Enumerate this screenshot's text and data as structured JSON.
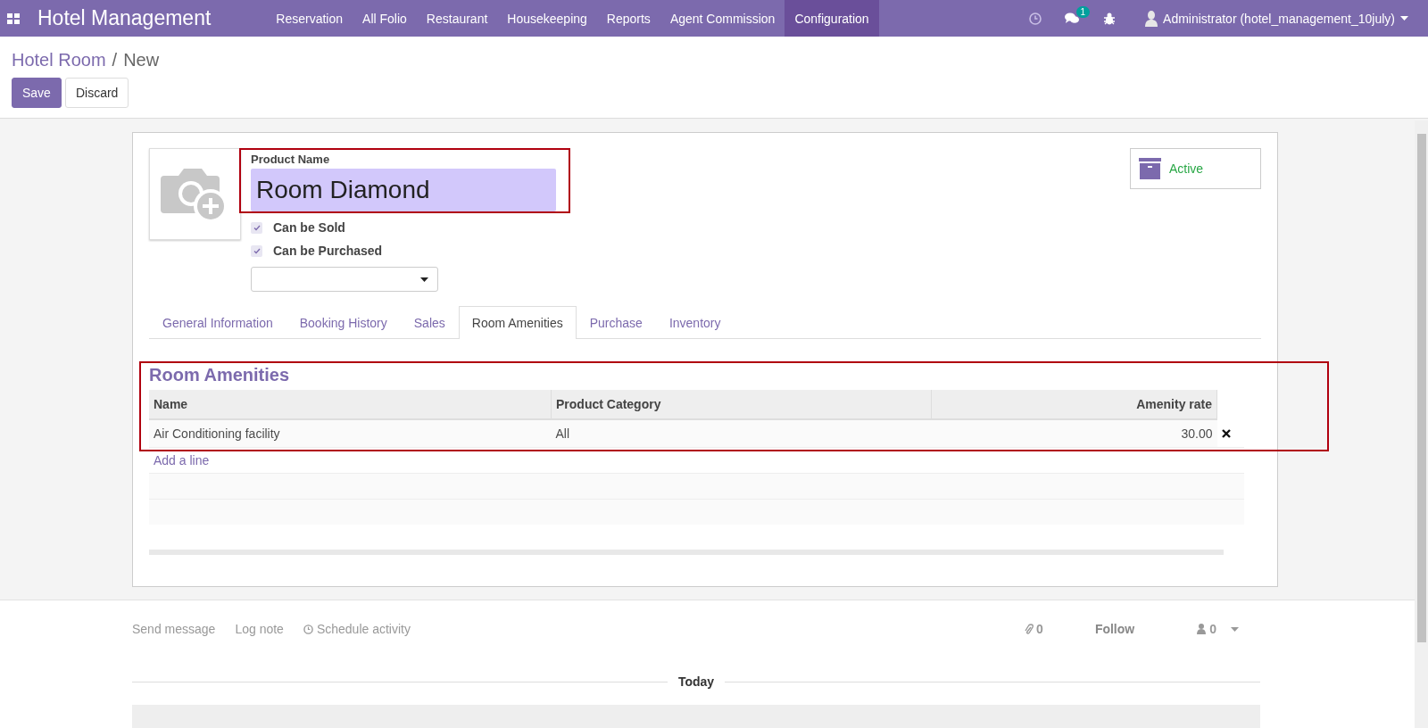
{
  "navbar": {
    "app_title": "Hotel Management",
    "menu": [
      {
        "label": "Reservation",
        "selected": false
      },
      {
        "label": "All Folio",
        "selected": false
      },
      {
        "label": "Restaurant",
        "selected": false
      },
      {
        "label": "Housekeeping",
        "selected": false
      },
      {
        "label": "Reports",
        "selected": false
      },
      {
        "label": "Agent Commission",
        "selected": false
      },
      {
        "label": "Configuration",
        "selected": true
      }
    ],
    "messages_badge": "1",
    "user": "Administrator (hotel_management_10july)"
  },
  "breadcrumb": {
    "parent": "Hotel Room",
    "separator": "/",
    "current": "New"
  },
  "buttons": [
    "Save",
    "Discard"
  ],
  "form": {
    "name_label": "Product Name",
    "name_value": "Room Diamond",
    "checkboxes": [
      {
        "label": "Can be Sold",
        "checked": true
      },
      {
        "label": "Can be Purchased",
        "checked": true
      }
    ],
    "active_button": "Active",
    "tabs": [
      {
        "label": "General Information",
        "selected": false
      },
      {
        "label": "Booking History",
        "selected": false
      },
      {
        "label": "Sales",
        "selected": false
      },
      {
        "label": "Room Amenities",
        "selected": true
      },
      {
        "label": "Purchase",
        "selected": false
      },
      {
        "label": "Inventory",
        "selected": false
      }
    ],
    "amenities": {
      "title": "Room Amenities",
      "columns": [
        "Name",
        "Product Category",
        "Amenity rate"
      ],
      "rows": [
        {
          "name": "Air Conditioning facility",
          "category": "All",
          "rate": "30.00"
        }
      ],
      "add_line": "Add a line"
    }
  },
  "chatter": {
    "actions": [
      "Send message",
      "Log note",
      "Schedule activity"
    ],
    "attachments": "0",
    "follow": "Follow",
    "followers": "0",
    "separator": "Today"
  }
}
